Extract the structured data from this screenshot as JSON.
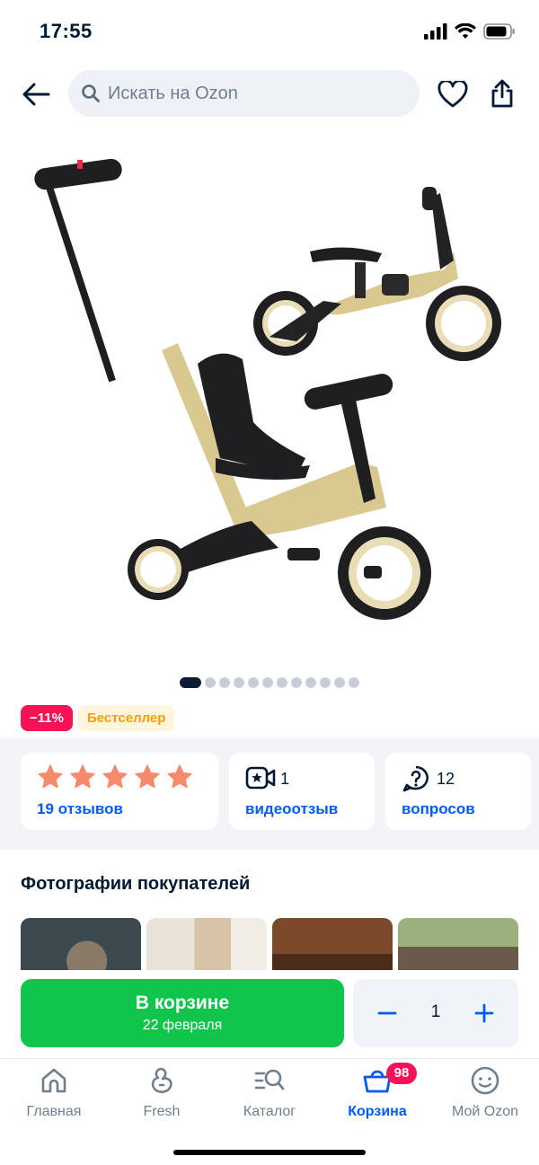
{
  "status_bar": {
    "time": "17:55"
  },
  "search": {
    "placeholder": "Искать на Ozon"
  },
  "gallery": {
    "total_images": 12,
    "active_index": 0
  },
  "badges": {
    "discount": "−11%",
    "label": "Бестселлер"
  },
  "reviews_card": {
    "rating": 5,
    "link": "19 отзывов"
  },
  "video_card": {
    "count": "1",
    "link": "видеоотзыв"
  },
  "questions_card": {
    "count": "12",
    "link": "вопросов"
  },
  "customer_photos": {
    "title": "Фотографии покупателей"
  },
  "cart_button": {
    "label": "В корзине",
    "delivery": "22 февраля"
  },
  "stepper": {
    "quantity": "1"
  },
  "tabbar": {
    "items": [
      {
        "label": "Главная"
      },
      {
        "label": "Fresh"
      },
      {
        "label": "Каталог"
      },
      {
        "label": "Корзина"
      },
      {
        "label": "Мой Ozon"
      }
    ],
    "cart_badge": "98",
    "active": "Корзина"
  },
  "colors": {
    "accent": "#005bff",
    "green": "#10c44c",
    "discount": "#f91155",
    "star": "#f58a6c"
  }
}
